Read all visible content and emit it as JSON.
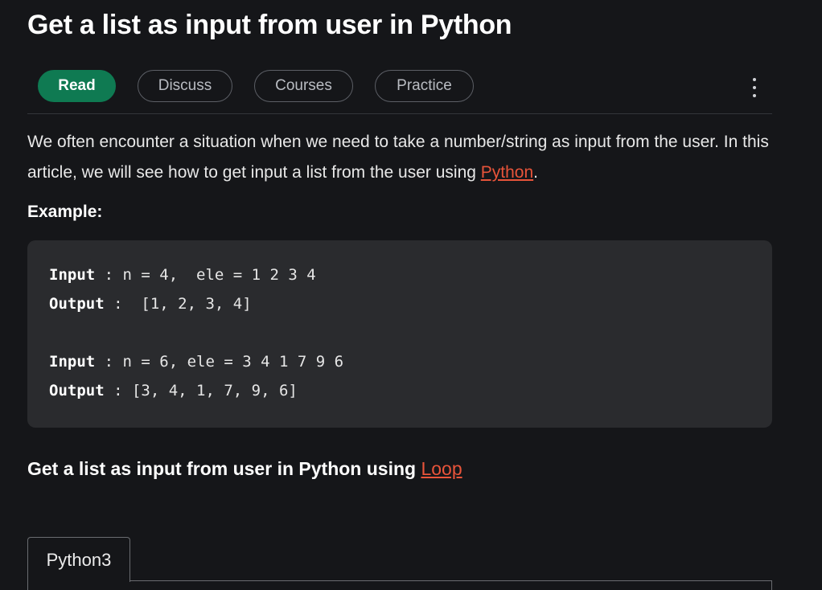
{
  "article": {
    "title": "Get a list as input from user in Python"
  },
  "tabs": [
    {
      "label": "Read",
      "active": true
    },
    {
      "label": "Discuss",
      "active": false
    },
    {
      "label": "Courses",
      "active": false
    },
    {
      "label": "Practice",
      "active": false
    }
  ],
  "more_menu_icon": "vertical-ellipsis-icon",
  "intro": {
    "text_before_link": "We often encounter a situation when we need to take a number/string as input from the user. In this article, we will see how to get input a list from the user using ",
    "link_text": "Python",
    "text_after_link": "."
  },
  "example_label": "Example:",
  "code_example": {
    "lines": [
      {
        "keyword": "Input",
        "rest": " : n = 4,  ele = 1 2 3 4"
      },
      {
        "keyword": "Output",
        "rest": " :  [1, 2, 3, 4]"
      },
      {
        "keyword": "Input",
        "rest": " : n = 6, ele = 3 4 1 7 9 6"
      },
      {
        "keyword": "Output",
        "rest": " : [3, 4, 1, 7, 9, 6]"
      }
    ]
  },
  "section": {
    "heading_text": "Get a list as input from user in Python using ",
    "heading_link": "Loop"
  },
  "code_tabs": [
    "Python3"
  ],
  "colors": {
    "background": "#151619",
    "accent_green": "#0f7a52",
    "link": "#e8543a",
    "code_background": "#2a2b2e"
  }
}
